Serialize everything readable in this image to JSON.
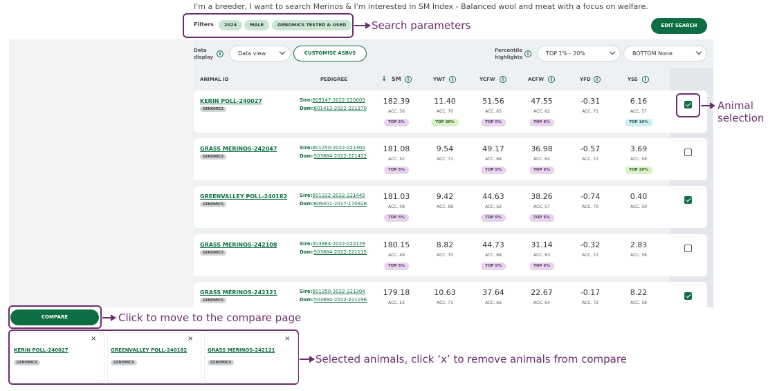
{
  "question": "I'm a breeder, I want to search Merinos & I'm interested in SM Index - Balanced wool and meat with a focus on welfare.",
  "filters": {
    "label": "Filters",
    "chips": [
      "2024",
      "MALE",
      "GENOMICS TESTED & USED"
    ]
  },
  "edit_search_label": "EDIT SEARCH",
  "controls": {
    "data_display_label": "Data display",
    "data_view_value": "Data view",
    "customise_label": "CUSTOMISE ASBVS",
    "percentile_label": "Percentile highlights",
    "top_value": "TOP 1% - 20%",
    "bottom_value": "BOTTOM None"
  },
  "columns": {
    "animal_id": "ANIMAL ID",
    "pedigree": "PEDIGREE",
    "sm": "SM",
    "ywt": "YWT",
    "ycfw": "YCFW",
    "acfw": "ACFW",
    "yfd": "YFD",
    "yss": "YSS"
  },
  "rows": [
    {
      "name": "KERIN POLL-240027",
      "badge": "GENOMICS",
      "sire_label": "Sire:",
      "sire": "609147-2022-220003",
      "dam_label": "Dam:",
      "dam": "601413-2022-221370",
      "sm": "182.39",
      "sm_acc": "ACC. 56",
      "sm_pill": "TOP 5%",
      "ywt": "11.40",
      "ywt_acc": "ACC. 70",
      "ywt_pill": "TOP 20%",
      "ycfw": "51.56",
      "ycfw_acc": "ACC. 65",
      "ycfw_pill": "TOP 5%",
      "acfw": "47.55",
      "acfw_acc": "ACC. 62",
      "acfw_pill": "TOP 5%",
      "yfd": "-0.31",
      "yfd_acc": "ACC. 71",
      "yfd_pill": "",
      "yss": "6.16",
      "yss_acc": "ACC. 57",
      "yss_pill": "TOP 10%",
      "selected": true
    },
    {
      "name": "GRASS MERINOS-242047",
      "badge": "GENOMICS",
      "sire_label": "Sire:",
      "sire": "601250-2022-221304",
      "dam_label": "Dam:",
      "dam": "503884-2022-221412",
      "sm": "181.08",
      "sm_acc": "ACC. 52",
      "sm_pill": "TOP 5%",
      "ywt": "9.54",
      "ywt_acc": "ACC. 71",
      "ywt_pill": "",
      "ycfw": "49.17",
      "ycfw_acc": "ACC. 66",
      "ycfw_pill": "TOP 5%",
      "acfw": "36.98",
      "acfw_acc": "ACC. 62",
      "acfw_pill": "TOP 5%",
      "yfd": "-0.57",
      "yfd_acc": "ACC. 72",
      "yfd_pill": "",
      "yss": "3.69",
      "yss_acc": "ACC. 58",
      "yss_pill": "TOP 20%",
      "selected": false
    },
    {
      "name": "GREENVALLEY POLL-240182",
      "badge": "GENOMICS",
      "sire_label": "Sire:",
      "sire": "601332-2022-221445",
      "dam_label": "Dam:",
      "dam": "609401-2017-170928",
      "sm": "181.03",
      "sm_acc": "ACC. 48",
      "sm_pill": "TOP 5%",
      "ywt": "9.42",
      "ywt_acc": "ACC. 68",
      "ywt_pill": "",
      "ycfw": "44.63",
      "ycfw_acc": "ACC. 62",
      "ycfw_pill": "TOP 5%",
      "acfw": "38.26",
      "acfw_acc": "ACC. 57",
      "acfw_pill": "TOP 5%",
      "yfd": "-0.74",
      "yfd_acc": "ACC. 70",
      "yfd_pill": "",
      "yss": "0.40",
      "yss_acc": "ACC. 50",
      "yss_pill": "",
      "selected": true
    },
    {
      "name": "GRASS MERINOS-242108",
      "badge": "GENOMICS",
      "sire_label": "Sire:",
      "sire": "503884-2022-222129",
      "dam_label": "Dam:",
      "dam": "503884-2022-221115",
      "sm": "180.15",
      "sm_acc": "ACC. 49",
      "sm_pill": "TOP 5%",
      "ywt": "8.82",
      "ywt_acc": "ACC. 70",
      "ywt_pill": "",
      "ycfw": "44.73",
      "ycfw_acc": "ACC. 66",
      "ycfw_pill": "TOP 5%",
      "acfw": "31.14",
      "acfw_acc": "ACC. 63",
      "acfw_pill": "TOP 5%",
      "yfd": "-0.32",
      "yfd_acc": "ACC. 72",
      "yfd_pill": "",
      "yss": "2.83",
      "yss_acc": "ACC. 58",
      "yss_pill": "",
      "selected": false
    },
    {
      "name": "GRASS MERINOS-242121",
      "badge": "GENOMICS",
      "sire_label": "Sire:",
      "sire": "601250-2022-221304",
      "dam_label": "Dam:",
      "dam": "503884-2022-221196",
      "sm": "179.18",
      "sm_acc": "ACC. 52",
      "sm_pill": "",
      "ywt": "10.63",
      "ywt_acc": "ACC. 71",
      "ywt_pill": "",
      "ycfw": "37.64",
      "ycfw_acc": "ACC. 66",
      "ycfw_pill": "",
      "acfw": "22.67",
      "acfw_acc": "ACC. 64",
      "acfw_pill": "",
      "yfd": "-0.17",
      "yfd_acc": "ACC. 72",
      "yfd_pill": "",
      "yss": "8.22",
      "yss_acc": "ACC. 58",
      "yss_pill": "",
      "selected": true
    }
  ],
  "compare_label": "COMPARE",
  "tray": [
    {
      "name": "KERIN POLL-240027",
      "badge": "GENOMICS",
      "close": "×"
    },
    {
      "name": "GREENVALLEY POLL-240182",
      "badge": "GENOMICS",
      "close": "×"
    },
    {
      "name": "GRASS MERINOS-242121",
      "badge": "GENOMICS",
      "close": "×"
    }
  ],
  "annotations": {
    "search_parameters": "Search parameters",
    "animal_selection": "Animal selection",
    "compare_page": "Click to move to the compare page",
    "selected_animals": "Selected animals, click ‘x’ to remove animals from compare"
  },
  "info_glyph": "i",
  "sort_glyph": "↓"
}
